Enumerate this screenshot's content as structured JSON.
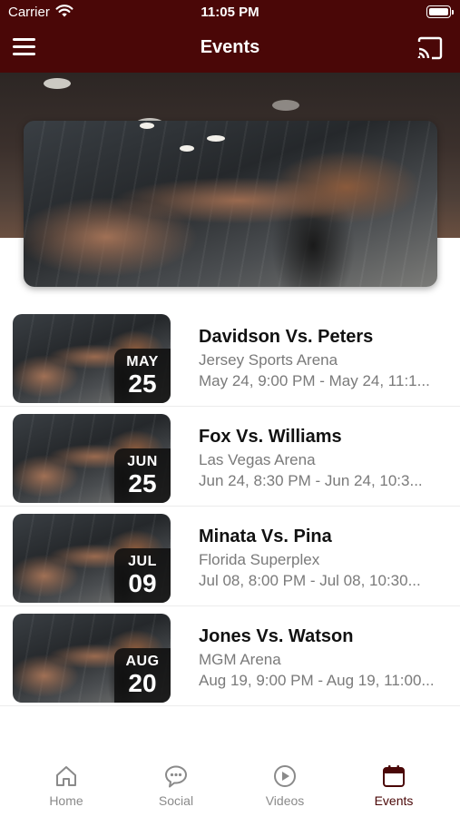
{
  "status_bar": {
    "carrier": "Carrier",
    "time": "11:05 PM"
  },
  "nav": {
    "title": "Events"
  },
  "events": [
    {
      "month": "MAY",
      "day": "25",
      "title": "Davidson Vs. Peters",
      "venue": "Jersey Sports Arena",
      "time": "May 24, 9:00 PM - May 24, 11:1..."
    },
    {
      "month": "JUN",
      "day": "25",
      "title": "Fox Vs. Williams",
      "venue": "Las Vegas Arena",
      "time": "Jun 24, 8:30 PM - Jun 24, 10:3..."
    },
    {
      "month": "JUL",
      "day": "09",
      "title": "Minata Vs. Pina",
      "venue": "Florida Superplex",
      "time": "Jul 08, 8:00 PM - Jul 08, 10:30..."
    },
    {
      "month": "AUG",
      "day": "20",
      "title": "Jones Vs. Watson",
      "venue": "MGM Arena",
      "time": "Aug 19, 9:00 PM - Aug 19, 11:00..."
    }
  ],
  "tabs": [
    {
      "label": "Home",
      "icon": "home-icon"
    },
    {
      "label": "Social",
      "icon": "chat-bubble-icon"
    },
    {
      "label": "Videos",
      "icon": "play-circle-icon"
    },
    {
      "label": "Events",
      "icon": "calendar-icon",
      "active": true
    }
  ],
  "colors": {
    "brand": "#4a0707",
    "inactive_tab": "#8a8a8a",
    "text_primary": "#111111",
    "text_secondary": "#7a7a7a"
  }
}
